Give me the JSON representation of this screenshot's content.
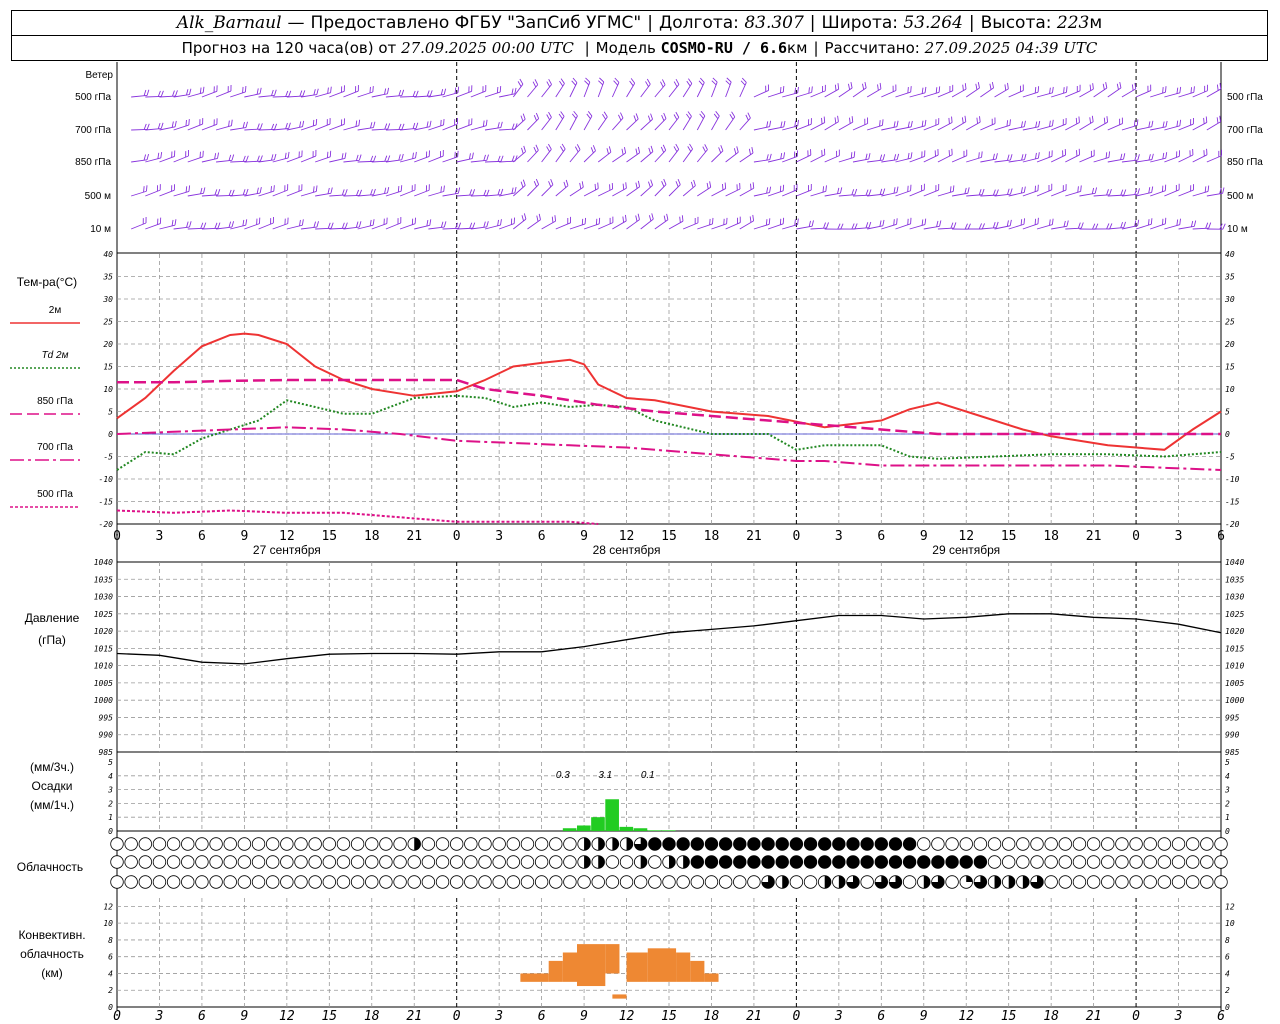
{
  "header": {
    "station": "Alk_Barnaul",
    "dash": "—",
    "provider": "Предоставлено ФГБУ \"ЗапСиб УГМС\"",
    "lon_label": "Долгота:",
    "lon_value": "83.307",
    "lat_label": "Широта:",
    "lat_value": "53.264",
    "alt_label": "Высота:",
    "alt_value": "223",
    "alt_unit": "м",
    "forecast_text": "Прогноз на 120 часа(ов) от",
    "forecast_start": "27.09.2025 00:00 UTC",
    "model_label": "Модель",
    "model_name": "COSMO-RU / 6.6",
    "model_unit": "км",
    "calc_label": "Рассчитано:",
    "calc_time": "27.09.2025 04:39 UTC"
  },
  "colors": {
    "t2m": "#ee3333",
    "td2m": "#228822",
    "t850": "#dd1188",
    "t700": "#dd1188",
    "t500": "#dd1188",
    "wind": "#8833dd",
    "pressure": "#000000",
    "precip": "#22cc22",
    "convective": "#ee8833",
    "grid": "#999999"
  },
  "panels": {
    "wind": {
      "title": "Ветер",
      "levels": [
        "500 гПа",
        "700 гПа",
        "850 гПа",
        "500 м",
        "10 м"
      ]
    },
    "temperature": {
      "title": "Тем-ра(°С)",
      "legend": [
        {
          "text": "2м",
          "key": "t2m"
        },
        {
          "text": "Td 2м",
          "key": "td2m"
        },
        {
          "text": "850 гПа",
          "key": "t850"
        },
        {
          "text": "700 гПа",
          "key": "t700"
        },
        {
          "text": "500 гПа",
          "key": "t500"
        }
      ],
      "y_ticks": [
        "40",
        "35",
        "30",
        "25",
        "20",
        "15",
        "10",
        "5",
        "0",
        "-5",
        "-10",
        "-15",
        "-20"
      ]
    },
    "pressure": {
      "title_line1": "Давление",
      "title_line2": "(гПа)",
      "y_ticks": [
        "1040",
        "1035",
        "1030",
        "1025",
        "1020",
        "1015",
        "1010",
        "1005",
        "1000",
        "995",
        "990",
        "985"
      ]
    },
    "precip": {
      "unit1": "(мм/3ч.)",
      "title": "Осадки",
      "unit2": "(мм/1ч.)",
      "y_ticks": [
        "5",
        "4",
        "3",
        "2",
        "1",
        "0"
      ],
      "totals": [
        "0.3",
        "3.1",
        "0.1"
      ]
    },
    "clouds": {
      "title": "Облачность"
    },
    "convective": {
      "title_line1": "Конвективн.",
      "title_line2": "облачность",
      "title_line3": "(км)",
      "y_ticks": [
        "12",
        "10",
        "8",
        "6",
        "4",
        "2",
        "0"
      ]
    }
  },
  "x_axis": {
    "hour_labels": [
      "0",
      "3",
      "6",
      "9",
      "12",
      "15",
      "18",
      "21",
      "0",
      "3",
      "6",
      "9",
      "12",
      "15",
      "18",
      "21",
      "0",
      "3",
      "6",
      "9",
      "12",
      "15",
      "18",
      "21",
      "0",
      "3",
      "6"
    ],
    "day_labels": [
      "27 сентября",
      "28 сентября",
      "29 сентября"
    ]
  },
  "chart_data": {
    "type": "line",
    "x_unit": "hours since 27.09.2025 00:00 UTC",
    "x_range": [
      0,
      78
    ],
    "temperature": {
      "ylim": [
        -20,
        40
      ],
      "series": [
        {
          "name": "2м",
          "key": "t2m",
          "x": [
            0,
            2,
            4,
            6,
            8,
            9,
            10,
            12,
            14,
            16,
            18,
            21,
            24,
            26,
            28,
            30,
            32,
            33,
            34,
            36,
            38,
            42,
            46,
            50,
            54,
            56,
            58,
            62,
            64,
            66,
            70,
            74,
            76,
            78
          ],
          "y": [
            3.5,
            8,
            14,
            19.5,
            22,
            22.3,
            22,
            20,
            15,
            12,
            10,
            8.5,
            9.5,
            12,
            15,
            15.8,
            16.5,
            15.5,
            11,
            8,
            7.5,
            5,
            4,
            1.5,
            3,
            5.5,
            7,
            3,
            1,
            -0.5,
            -2.5,
            -3.5,
            1,
            5
          ]
        },
        {
          "name": "Td 2м",
          "key": "td2m",
          "x": [
            0,
            2,
            4,
            6,
            8,
            10,
            12,
            14,
            16,
            18,
            21,
            24,
            26,
            28,
            30,
            32,
            34,
            36,
            38,
            42,
            46,
            48,
            50,
            54,
            56,
            58,
            62,
            66,
            70,
            74,
            76,
            78
          ],
          "y": [
            -8,
            -4,
            -4.5,
            -1,
            1,
            3,
            7.5,
            6,
            4.5,
            4.5,
            8,
            8.5,
            8,
            6,
            7,
            6,
            6.5,
            6,
            3,
            0,
            0,
            -3.5,
            -2.5,
            -2.5,
            -5,
            -5.5,
            -5,
            -4.5,
            -4.5,
            -5,
            -4.5,
            -4
          ]
        },
        {
          "name": "850 гПа",
          "key": "t850",
          "x": [
            0,
            4,
            8,
            12,
            16,
            20,
            24,
            26,
            30,
            34,
            38,
            42,
            46,
            50,
            54,
            58,
            62,
            66,
            70,
            74,
            78
          ],
          "y": [
            11.5,
            11.5,
            11.8,
            12,
            12,
            12,
            12,
            10,
            8.5,
            6.5,
            5,
            4,
            3,
            2,
            1,
            0,
            0,
            0,
            0,
            0,
            0
          ]
        },
        {
          "name": "700 гПа",
          "key": "t700",
          "x": [
            0,
            4,
            8,
            12,
            16,
            20,
            24,
            28,
            32,
            36,
            40,
            44,
            48,
            50,
            54,
            58,
            62,
            66,
            70,
            74,
            78
          ],
          "y": [
            0,
            0.5,
            1,
            1.5,
            1,
            0,
            -1.5,
            -2,
            -2.5,
            -3,
            -4,
            -5,
            -6,
            -6,
            -7,
            -7,
            -7,
            -7,
            -7,
            -7.5,
            -8
          ]
        },
        {
          "name": "500 гПа",
          "key": "t500",
          "x": [
            0,
            4,
            8,
            12,
            16,
            20,
            24,
            28,
            32,
            34
          ],
          "y": [
            -17,
            -17.5,
            -17,
            -17.5,
            -17.5,
            -18.5,
            -19.5,
            -19.5,
            -19.5,
            -20
          ]
        }
      ]
    },
    "pressure": {
      "ylim": [
        985,
        1040
      ],
      "x": [
        0,
        3,
        6,
        9,
        12,
        15,
        18,
        21,
        24,
        27,
        30,
        33,
        36,
        39,
        42,
        45,
        48,
        51,
        54,
        57,
        60,
        63,
        66,
        69,
        72,
        75,
        78
      ],
      "y": [
        1013.5,
        1013,
        1011,
        1010.5,
        1012,
        1013.3,
        1013.5,
        1013.5,
        1013.3,
        1014,
        1014,
        1015.5,
        1017.5,
        1019.5,
        1020.5,
        1021.5,
        1023,
        1024.5,
        1024.5,
        1023.5,
        1024,
        1025,
        1025,
        1024,
        1023.5,
        1022,
        1019.5
      ]
    },
    "precipitation": {
      "ylim": [
        0,
        5
      ],
      "unit": "мм/1ч",
      "x": [
        32,
        33,
        34,
        35,
        36,
        37,
        38,
        39
      ],
      "y": [
        0.2,
        0.4,
        1.0,
        2.3,
        0.3,
        0.2,
        0.05,
        0.05
      ]
    },
    "convective_cloud": {
      "ylim": [
        0,
        13
      ],
      "unit": "км",
      "blocks": [
        {
          "x0": 28.5,
          "x1": 30.5,
          "base": 3.0,
          "top": 4.0
        },
        {
          "x0": 30.5,
          "x1": 31.5,
          "base": 3.0,
          "top": 5.5
        },
        {
          "x0": 31.5,
          "x1": 32.5,
          "base": 3.0,
          "top": 6.5
        },
        {
          "x0": 32.5,
          "x1": 34.5,
          "base": 2.5,
          "top": 7.5
        },
        {
          "x0": 34.5,
          "x1": 35.5,
          "base": 4.0,
          "top": 7.5
        },
        {
          "x0": 35.0,
          "x1": 36.0,
          "base": 1.0,
          "top": 1.5
        },
        {
          "x0": 36.0,
          "x1": 37.5,
          "base": 3.0,
          "top": 6.5
        },
        {
          "x0": 37.5,
          "x1": 39.5,
          "base": 3.0,
          "top": 7.0
        },
        {
          "x0": 39.5,
          "x1": 40.5,
          "base": 3.0,
          "top": 6.5
        },
        {
          "x0": 40.5,
          "x1": 41.5,
          "base": 3.0,
          "top": 5.5
        },
        {
          "x0": 41.5,
          "x1": 42.5,
          "base": 3.0,
          "top": 4.0
        }
      ]
    },
    "cloud_cover": {
      "x_step_hours": 1,
      "rows": {
        "upper": "0000000000000000000002000000000002222344444444444444444440000000000000000000000002200002002202222333333",
        "middle": "0000000000000000000000000000000002200202244444444444444444444400000000000000000000000000000000000203300",
        "lower": "0000000000000000000000000000000000000000000000320022303302301322230000000000000000000000000000000000000000"
      }
    }
  }
}
